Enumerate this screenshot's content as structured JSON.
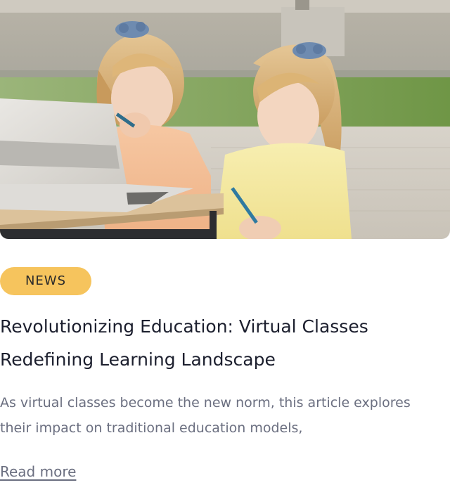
{
  "article": {
    "image_alt": "Two young girls drawing with pens next to a laptop on an outdoor table",
    "tag": "NEWS",
    "title": "Revolutionizing Education: Virtual Classes Redefining Learning Landscape",
    "excerpt": "As virtual classes become the new norm, this article explores their impact on traditional education models,",
    "read_more": "Read more"
  },
  "colors": {
    "tag_background": "#f6c45d",
    "title_text": "#1c1f2e",
    "body_text": "#6b6f80"
  }
}
